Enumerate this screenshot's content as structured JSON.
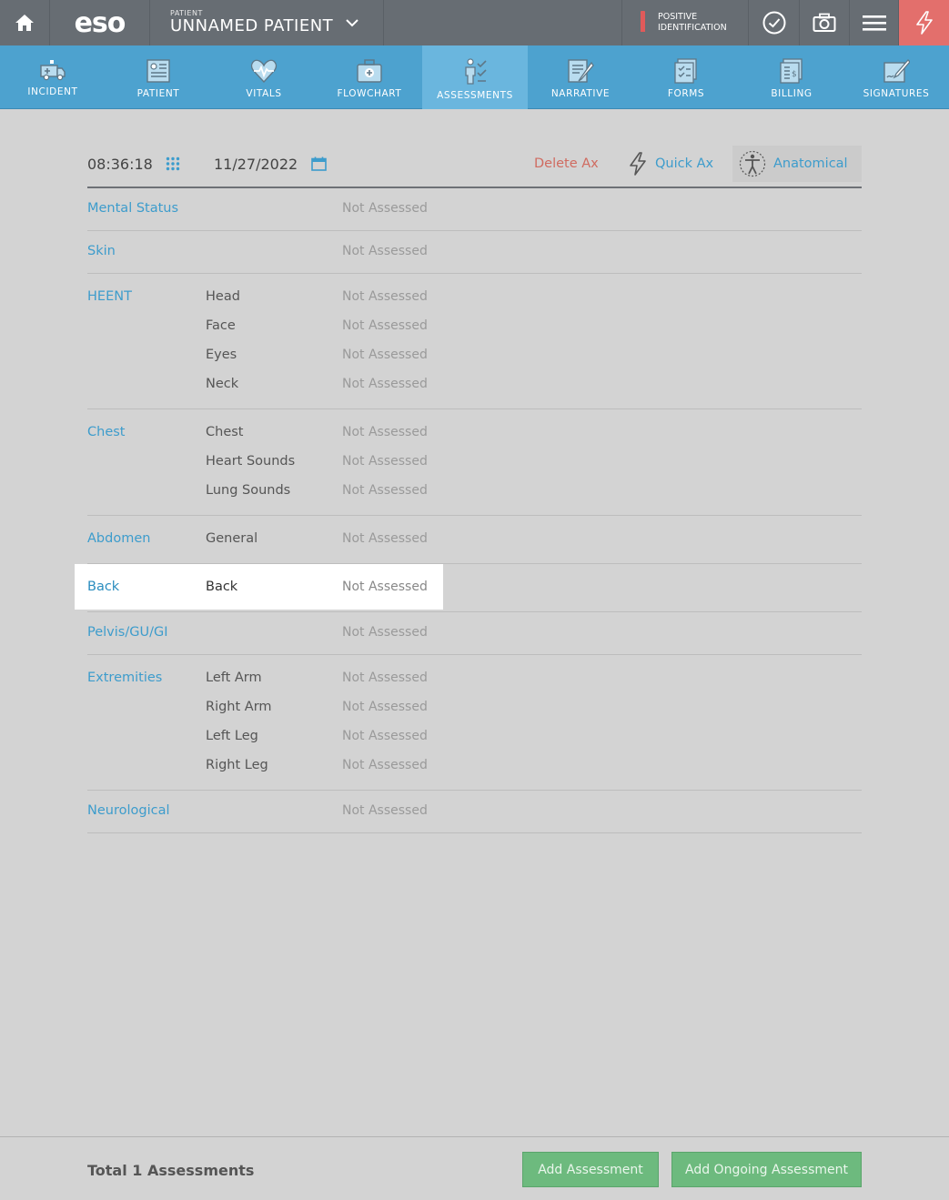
{
  "topbar": {
    "logo": "eso",
    "patient_label": "PATIENT",
    "patient_name": "UNNAMED PATIENT",
    "positive_id_line1": "POSITIVE",
    "positive_id_line2": "IDENTIFICATION",
    "alert_color": "#e05a5a",
    "bolt_bg": "#e36f6c"
  },
  "nav": {
    "tabs": [
      {
        "label": "INCIDENT",
        "icon": "ambulance-icon"
      },
      {
        "label": "PATIENT",
        "icon": "patient-card-icon"
      },
      {
        "label": "VITALS",
        "icon": "heartbeat-icon"
      },
      {
        "label": "FLOWCHART",
        "icon": "medkit-icon"
      },
      {
        "label": "ASSESSMENTS",
        "icon": "assessment-person-icon",
        "active": true
      },
      {
        "label": "NARRATIVE",
        "icon": "narrative-pencil-icon"
      },
      {
        "label": "FORMS",
        "icon": "forms-checklist-icon"
      },
      {
        "label": "BILLING",
        "icon": "billing-dollar-icon"
      },
      {
        "label": "SIGNATURES",
        "icon": "signature-icon"
      }
    ]
  },
  "toolbar": {
    "time": "08:36:18",
    "date": "11/27/2022",
    "delete_label": "Delete Ax",
    "quick_label": "Quick Ax",
    "anatomical_label": "Anatomical"
  },
  "assessment": {
    "mental_status": {
      "category": "Mental Status",
      "status": "Not Assessed"
    },
    "skin": {
      "category": "Skin",
      "status": "Not Assessed"
    },
    "heent": {
      "category": "HEENT",
      "items": [
        {
          "sub": "Head",
          "status": "Not Assessed"
        },
        {
          "sub": "Face",
          "status": "Not Assessed"
        },
        {
          "sub": "Eyes",
          "status": "Not Assessed"
        },
        {
          "sub": "Neck",
          "status": "Not Assessed"
        }
      ]
    },
    "chest": {
      "category": "Chest",
      "items": [
        {
          "sub": "Chest",
          "status": "Not Assessed"
        },
        {
          "sub": "Heart Sounds",
          "status": "Not Assessed"
        },
        {
          "sub": "Lung Sounds",
          "status": "Not Assessed"
        }
      ]
    },
    "abdomen": {
      "category": "Abdomen",
      "items": [
        {
          "sub": "General",
          "status": "Not Assessed"
        }
      ]
    },
    "back": {
      "category": "Back",
      "items": [
        {
          "sub": "Back",
          "status": "Not Assessed"
        }
      ]
    },
    "pelvis": {
      "category": "Pelvis/GU/GI",
      "status": "Not Assessed"
    },
    "extremities": {
      "category": "Extremities",
      "items": [
        {
          "sub": "Left Arm",
          "status": "Not Assessed"
        },
        {
          "sub": "Right Arm",
          "status": "Not Assessed"
        },
        {
          "sub": "Left Leg",
          "status": "Not Assessed"
        },
        {
          "sub": "Right Leg",
          "status": "Not Assessed"
        }
      ]
    },
    "neurological": {
      "category": "Neurological",
      "status": "Not Assessed"
    }
  },
  "footer": {
    "total": "Total 1 Assessments",
    "add_label": "Add Assessment",
    "ongoing_label": "Add Ongoing Assessment"
  }
}
